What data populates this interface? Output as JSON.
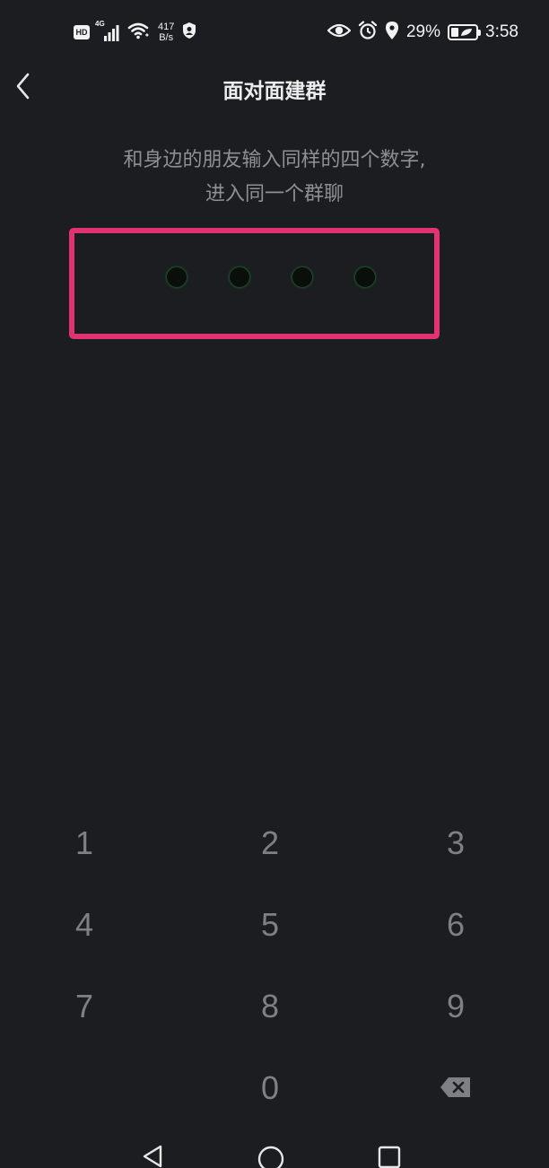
{
  "status_bar": {
    "hd_label": "HD",
    "network_type": "4G",
    "net_speed_value": "417",
    "net_speed_unit": "B/s",
    "battery_percent": "29%",
    "battery_level": 0.29,
    "time": "3:58"
  },
  "header": {
    "title": "面对面建群",
    "back_icon": "chevron-left-icon"
  },
  "instruction": {
    "line1": "和身边的朋友输入同样的四个数字,",
    "line2": "进入同一个群聊"
  },
  "code_entry": {
    "digits_entered": 0,
    "digit_slots": 4,
    "highlight_color": "#e0336f"
  },
  "keypad": {
    "keys": [
      "1",
      "2",
      "3",
      "4",
      "5",
      "6",
      "7",
      "8",
      "9",
      "0"
    ],
    "delete_icon": "backspace-icon"
  },
  "nav_bar": {
    "back_icon": "triangle-back-icon",
    "home_icon": "circle-home-icon",
    "recents_icon": "square-recents-icon"
  }
}
